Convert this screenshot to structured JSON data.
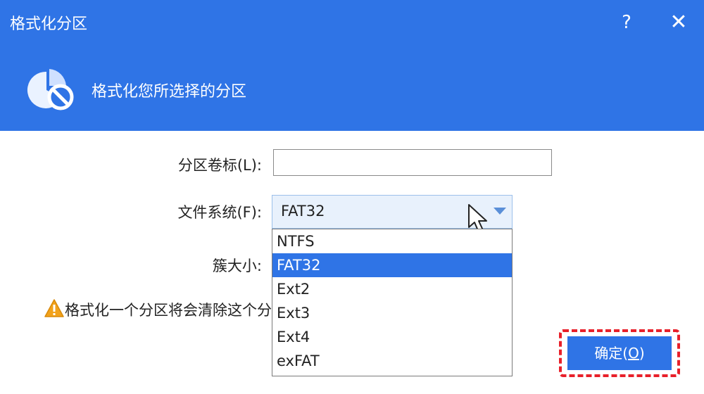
{
  "window": {
    "title": "格式化分区",
    "help_label": "?",
    "close_label": "✕"
  },
  "header": {
    "subtitle": "格式化您所选择的分区",
    "icon": "partition-format-icon"
  },
  "form": {
    "volume_label": "分区卷标(L):",
    "volume_value": "",
    "fs_label": "文件系统(F):",
    "fs_value": "FAT32",
    "cluster_label": "簇大小:"
  },
  "dropdown": {
    "options": [
      "NTFS",
      "FAT32",
      "Ext2",
      "Ext3",
      "Ext4",
      "exFAT"
    ],
    "selected": "FAT32"
  },
  "warning": {
    "icon": "warning-icon",
    "text": "格式化一个分区将会清除这个分区上的所有数据"
  },
  "buttons": {
    "confirm_text": "确定(",
    "confirm_key": "O",
    "confirm_close": ")"
  },
  "colors": {
    "accent": "#2f74e6",
    "highlight": "#e8202a"
  }
}
